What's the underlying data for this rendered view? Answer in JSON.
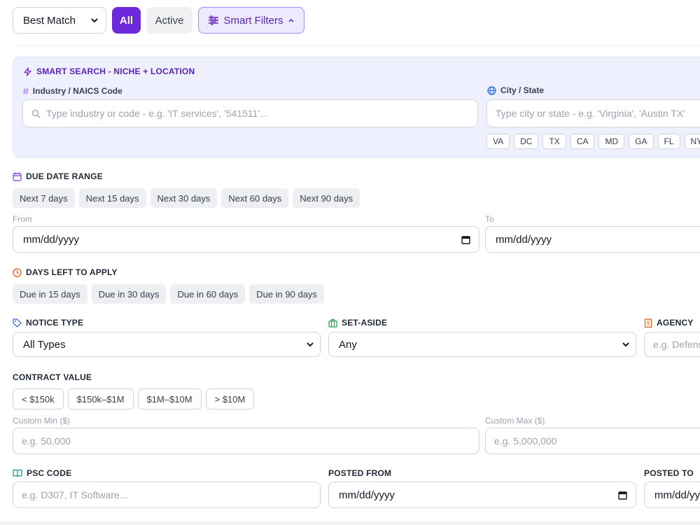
{
  "toolbar": {
    "sort_value": "Best Match",
    "all_label": "All",
    "active_label": "Active",
    "smart_filters_label": "Smart Filters"
  },
  "smart_search": {
    "title": "SMART SEARCH - NICHE + LOCATION",
    "industry_label": "Industry / NAICS Code",
    "industry_placeholder": "Type industry or code - e.g. 'IT services', '541511'...",
    "location_label": "City / State",
    "location_placeholder": "Type city or state - e.g. 'Virginia', 'Austin TX'",
    "states": [
      "VA",
      "DC",
      "TX",
      "CA",
      "MD",
      "GA",
      "FL",
      "NY"
    ]
  },
  "due_date": {
    "title": "DUE DATE RANGE",
    "presets": [
      "Next 7 days",
      "Next 15 days",
      "Next 30 days",
      "Next 60 days",
      "Next 90 days"
    ],
    "from_label": "From",
    "to_label": "To",
    "from_value": "mm/dd/yyyy",
    "to_value": "mm/dd/yyyy"
  },
  "days_left": {
    "title": "DAYS LEFT TO APPLY",
    "presets": [
      "Due in 15 days",
      "Due in 30 days",
      "Due in 60 days",
      "Due in 90 days"
    ]
  },
  "notice_type": {
    "title": "NOTICE TYPE",
    "value": "All Types"
  },
  "set_aside": {
    "title": "SET-ASIDE",
    "value": "Any"
  },
  "agency": {
    "title": "AGENCY",
    "placeholder": "e.g. Defense"
  },
  "contract_value": {
    "title": "CONTRACT VALUE",
    "presets": [
      "< $150k",
      "$150k–$1M",
      "$1M–$10M",
      "> $10M"
    ],
    "min_label": "Custom Min ($)",
    "min_placeholder": "e.g. 50,000",
    "max_label": "Custom Max ($)",
    "max_placeholder": "e.g. 5,000,000"
  },
  "psc": {
    "title": "PSC CODE",
    "placeholder": "e.g. D307, IT Software..."
  },
  "posted_from": {
    "title": "POSTED FROM",
    "value": "mm/dd/yyyy"
  },
  "posted_to": {
    "title": "POSTED TO",
    "value": "mm/dd/yyyy"
  },
  "colors": {
    "accent": "#6d28d9",
    "accent_light": "#ede9fe",
    "panel_tint": "#eef0fe"
  }
}
